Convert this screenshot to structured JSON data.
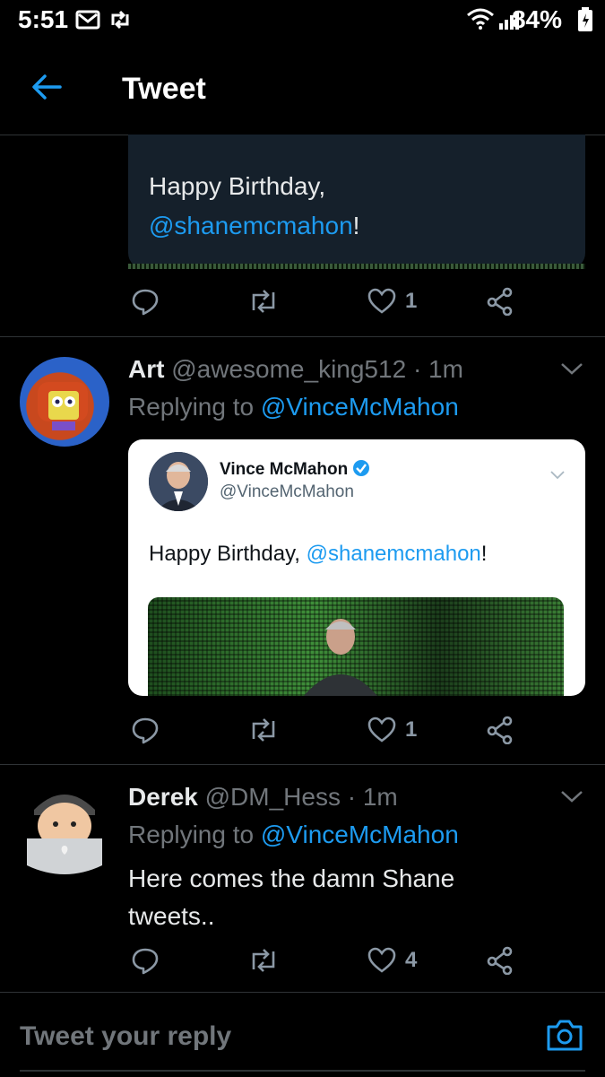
{
  "status_bar": {
    "time": "5:51",
    "battery": "84%",
    "icons": [
      "gmail-icon",
      "retweet-notification-icon",
      "wifi-icon",
      "signal-icon",
      "battery-icon"
    ]
  },
  "header": {
    "back_icon": "back-arrow-icon",
    "title": "Tweet"
  },
  "top_quote": {
    "text_line1": "Happy Birthday,",
    "mention": "@shanemcmahon",
    "exclaim": "!"
  },
  "top_actions": {
    "like_count": "1"
  },
  "replies": [
    {
      "name": "Art",
      "handle": "@awesome_king512",
      "sep": "·",
      "time": "1m",
      "replying_prefix": "Replying to",
      "replying_to": "@VinceMcMahon",
      "quoted": {
        "name": "Vince McMahon",
        "handle": "@VinceMcMahon",
        "text": "Happy Birthday, ",
        "mention": "@shanemcmahon",
        "exclaim": "!"
      },
      "like_count": "1"
    },
    {
      "name": "Derek",
      "handle": "@DM_Hess",
      "sep": "·",
      "time": "1m",
      "replying_prefix": "Replying to",
      "replying_to": "@VinceMcMahon",
      "text_line1": "Here comes the damn Shane",
      "text_line2": "tweets..",
      "like_count": "4"
    }
  ],
  "reply_bar": {
    "placeholder": "Tweet your reply",
    "camera_icon": "camera-icon"
  },
  "colors": {
    "accent": "#1d9bf0",
    "background": "#000000",
    "muted": "#71767b"
  }
}
